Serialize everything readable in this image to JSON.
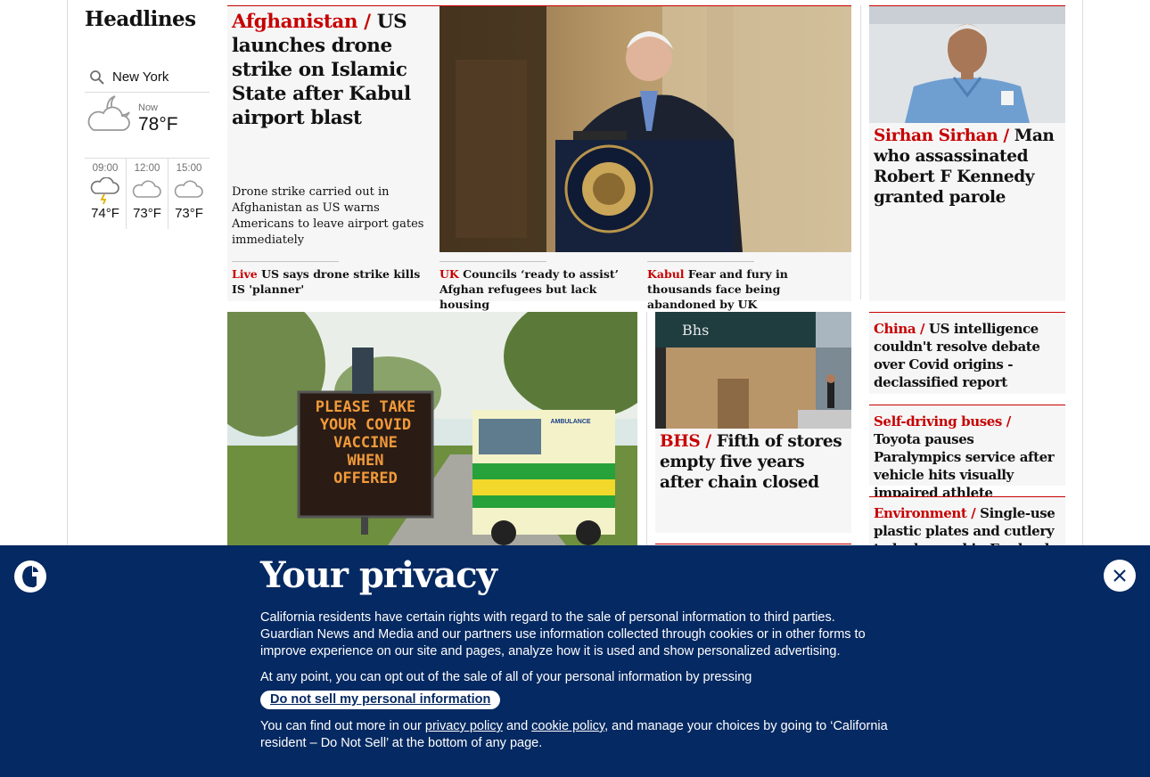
{
  "headlines": {
    "title": "Headlines"
  },
  "weather": {
    "city": "New York",
    "now_label": "Now",
    "now_temp": "78°F",
    "forecast": [
      {
        "time": "09:00",
        "temp": "74°F",
        "icon": "thunder-rain-icon"
      },
      {
        "time": "12:00",
        "temp": "73°F",
        "icon": "cloud-icon"
      },
      {
        "time": "15:00",
        "temp": "73°F",
        "icon": "cloud-icon"
      }
    ]
  },
  "main_story": {
    "kicker": "Afghanistan /",
    "headline": "US launches drone strike on Islamic State after Kabul airport blast",
    "standfirst": "Drone strike carried out in Afghanistan as US warns Americans to leave airport gates immediately",
    "sublinks": [
      {
        "kicker": "Live",
        "text": "US says drone strike kills IS 'planner'"
      },
      {
        "kicker": "UK",
        "text": "Councils ‘ready to assist’ Afghan refugees but lack housing"
      },
      {
        "kicker": "Kabul",
        "text": "Fear and fury in thousands face being abandoned by UK"
      }
    ]
  },
  "sirhan_story": {
    "kicker": "Sirhan Sirhan /",
    "headline": "Man who assassinated Robert F Kennedy granted parole"
  },
  "bhs_story": {
    "kicker": "BHS /",
    "headline": "Fifth of stores empty five years after chain closed",
    "sign_text": "Bhs"
  },
  "vaccine_sign": {
    "lines": [
      "PLEASE TAKE",
      "YOUR COVID",
      "VACCINE",
      "WHEN",
      "OFFERED"
    ],
    "ambulance_label": "AMBULANCE"
  },
  "small_stories": [
    {
      "kicker": "China /",
      "headline": "US intelligence couldn't resolve debate over Covid origins - declassified report"
    },
    {
      "kicker": "Self-driving buses  /",
      "headline": "Toyota pauses Paralympics service after vehicle hits visually impaired athlete"
    },
    {
      "kicker": "Environment /",
      "headline": "Single-use plastic plates and cutlery to be banned in England"
    }
  ],
  "privacy": {
    "title": "Your privacy",
    "para1": "California residents have certain rights with regard to the sale of personal information to third parties. Guardian News and Media and our partners use information collected through cookies or in other forms to improve experience on our site and pages, analyze how it is used and show personalized advertising.",
    "para2": "At any point, you can opt out of the sale of all of your personal information by pressing",
    "button": "Do not sell my personal information",
    "para3_a": "You can find out more in our",
    "privacy_link": "privacy policy",
    "para3_and": "and",
    "cookie_link": "cookie policy",
    "para3_b": ", and manage your choices by going to ‘California resident – Do Not Sell’ at the bottom of any page."
  },
  "colors": {
    "accent": "#c70000",
    "banner": "#052962"
  }
}
